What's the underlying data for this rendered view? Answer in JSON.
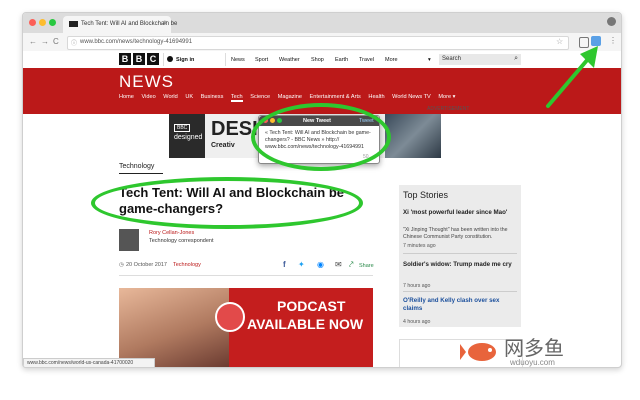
{
  "browser": {
    "tab_title": "Tech Tent: Will AI and Blockchain be",
    "tab_close": "×",
    "url": "www.bbc.com/news/technology-41694991",
    "back": "←",
    "forward": "→",
    "reload": "C",
    "menu": "⋮"
  },
  "bbc": {
    "logo_letters": [
      "B",
      "B",
      "C"
    ],
    "sign_in": "Sign in",
    "top_nav": [
      "News",
      "Sport",
      "Weather",
      "Shop",
      "Earth",
      "Travel",
      "More"
    ],
    "search_placeholder": "Search",
    "news_word": "NEWS",
    "sub_nav": [
      "Home",
      "Video",
      "World",
      "UK",
      "Business",
      "Tech",
      "Science",
      "Magazine",
      "Entertainment & Arts",
      "Health",
      "World News TV",
      "More ▾"
    ],
    "advertisement_label": "ADVERTISEMENT",
    "ad_brand_top": "BBC",
    "ad_brand_bottom": "designed",
    "ad_big": "DESIG",
    "ad_small": "Creativ"
  },
  "tweet_popup": {
    "title": "New Tweet",
    "action": "Tweet",
    "text": "« Tech Tent: Will AI and Blockchain be game-changers? - BBC News » http:// www.bbc.com/news/technology-41694991",
    "count": "50"
  },
  "article": {
    "section": "Technology",
    "headline": "Tech Tent: Will AI and Blockchain be game-changers?",
    "author_name": "Rory Cellan-Jones",
    "author_role": "Technology correspondent",
    "date": "20 October 2017",
    "section_link": "Technology",
    "share_label": "Share",
    "podcast_line1": "PODCAST",
    "podcast_line2": "AVAILABLE NOW"
  },
  "top_stories": {
    "title": "Top Stories",
    "items": [
      {
        "headline": "Xi 'most powerful leader since Mao'",
        "summary": "\"Xi Jinping Thought\" has been written into the Chinese Communist Party constitution.",
        "time": "7 minutes ago"
      },
      {
        "headline": "Soldier's widow: Trump made me cry",
        "summary": "",
        "time": "7 hours ago"
      },
      {
        "headline": "O'Reilly and Kelly clash over sex claims",
        "summary": "",
        "time": "4 hours ago"
      }
    ]
  },
  "status_url": "www.bbc.com/news/world-us-canada-41700020",
  "watermark": {
    "text": "网多鱼",
    "domain": "wduoyu.com"
  },
  "colors": {
    "bbc_red": "#bb1919",
    "highlight_green": "#2ec72e",
    "tab_bar": "#dcdcdc"
  }
}
